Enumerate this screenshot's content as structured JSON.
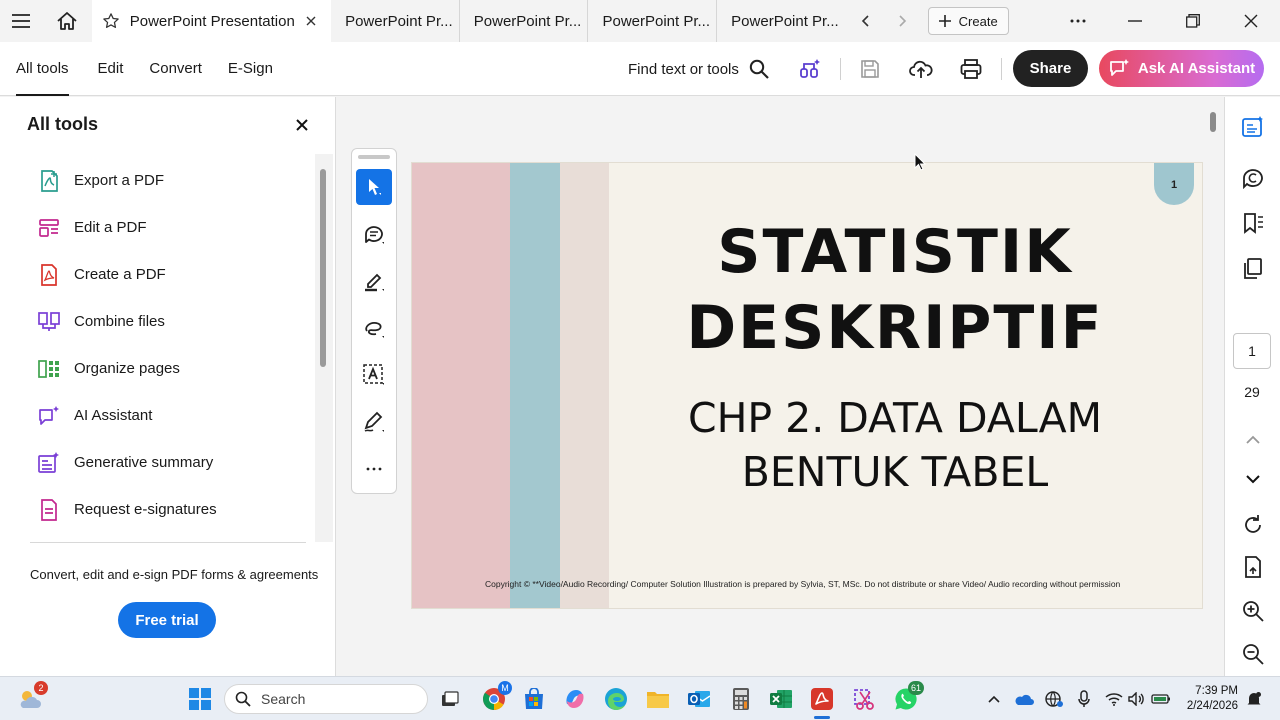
{
  "tabs": {
    "active": "PowerPoint Presentation",
    "others": [
      "PowerPoint Pr...",
      "PowerPoint Pr...",
      "PowerPoint Pr...",
      "PowerPoint Pr..."
    ],
    "create_label": "Create"
  },
  "toolbar": {
    "menu": [
      "All tools",
      "Edit",
      "Convert",
      "E-Sign"
    ],
    "find_label": "Find text or tools",
    "share_label": "Share",
    "ai_label": "Ask AI Assistant"
  },
  "left_panel": {
    "title": "All tools",
    "items": [
      {
        "label": "Export a PDF",
        "icon": "export-pdf-icon",
        "color": "#2a9d8f"
      },
      {
        "label": "Edit a PDF",
        "icon": "edit-pdf-icon",
        "color": "#c2278f"
      },
      {
        "label": "Create a PDF",
        "icon": "create-pdf-icon",
        "color": "#d9342b"
      },
      {
        "label": "Combine files",
        "icon": "combine-files-icon",
        "color": "#7a3fd6"
      },
      {
        "label": "Organize pages",
        "icon": "organize-pages-icon",
        "color": "#3fa34d"
      },
      {
        "label": "AI Assistant",
        "icon": "ai-assistant-icon",
        "color": "#7a3fd6"
      },
      {
        "label": "Generative summary",
        "icon": "generative-summary-icon",
        "color": "#7a3fd6"
      },
      {
        "label": "Request e-signatures",
        "icon": "request-esignatures-icon",
        "color": "#c2278f"
      }
    ],
    "promo_text": "Convert, edit and e-sign PDF forms & agreements",
    "free_trial_label": "Free trial"
  },
  "slide": {
    "page_badge": "1",
    "title_line1": "STATISTIK",
    "title_line2": "DESKRIPTIF",
    "subtitle_line1": "CHP 2. DATA DALAM",
    "subtitle_line2": "BENTUK TABEL",
    "copyright": "Copyright © **Video/Audio Recording/ Computer Solution Illustration is prepared  by Sylvia, ST, MSc. Do not distribute or share Video/ Audio recording without permission",
    "stripe_colors": [
      "#e6c3c5",
      "#a3c8cf",
      "#e8ddd7"
    ]
  },
  "navigation": {
    "current_page": "1",
    "total_pages": "29"
  },
  "taskbar": {
    "search_placeholder": "Search",
    "weather_badge": "2",
    "chrome_badge": "M",
    "whatsapp_badge": "61",
    "time": "7:39 PM",
    "date": "2/24/2026"
  },
  "colors": {
    "accent": "#1473e6",
    "share_bg": "#222222",
    "ai_gradient_start": "#e8495f",
    "ai_gradient_end": "#b56cf0"
  }
}
